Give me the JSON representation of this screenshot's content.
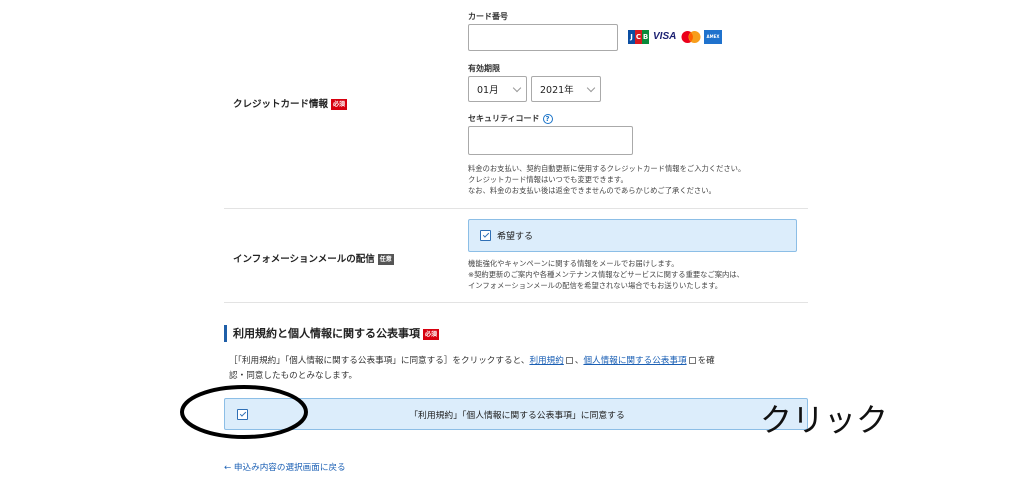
{
  "credit_card": {
    "row_label": "クレジットカード情報",
    "required_badge": "必須",
    "card_number_label": "カード番号",
    "card_number_value": "",
    "logos": [
      "jcb-logo",
      "visa-logo",
      "mastercard-logo",
      "amex-logo"
    ],
    "visa_text": "VISA",
    "jcb_letters": [
      "J",
      "C",
      "B"
    ],
    "amex_text": "AMEX",
    "expiry_label": "有効期限",
    "expiry_month": "01月",
    "expiry_year": "2021年",
    "security_label": "セキュリティコード",
    "security_help": "?",
    "security_value": "",
    "notes": [
      "料金のお支払い、契約自動更新に使用するクレジットカード情報をご入力ください。",
      "クレジットカード情報はいつでも変更できます。",
      "なお、料金のお支払い後は返金できませんのであらかじめご了承ください。"
    ]
  },
  "info_mail": {
    "row_label": "インフォメーションメールの配信",
    "optional_badge": "任意",
    "checkbox_label": "希望する",
    "checked": true,
    "notes": [
      "機能強化やキャンペーンに関する情報をメールでお届けします。",
      "※契約更新のご案内や各種メンテナンス情報などサービスに関する重要なご案内は、",
      "インフォメーションメールの配信を希望されない場合でもお送りいたします。"
    ]
  },
  "terms": {
    "title": "利用規約と個人情報に関する公表事項",
    "required_badge": "必須",
    "desc_prefix": "［「利用規約」「個人情報に関する公表事項」に同意する］をクリックすると、",
    "link_terms": "利用規約",
    "sep": "、",
    "link_privacy": "個人情報に関する公表事項",
    "desc_suffix": "を確",
    "desc_line2": "認・同意したものとみなします。",
    "agree_label": "「利用規約」「個人情報に関する公表事項」に同意する",
    "checked": true
  },
  "annotation": {
    "click_text": "クリック"
  },
  "back_link": "← 申込み内容の選択画面に戻る",
  "colors": {
    "accent_blue": "#1f5fa8",
    "required_red": "#d7000f",
    "checkbox_bg": "#dcedfb",
    "annotation_black": "#000000"
  }
}
